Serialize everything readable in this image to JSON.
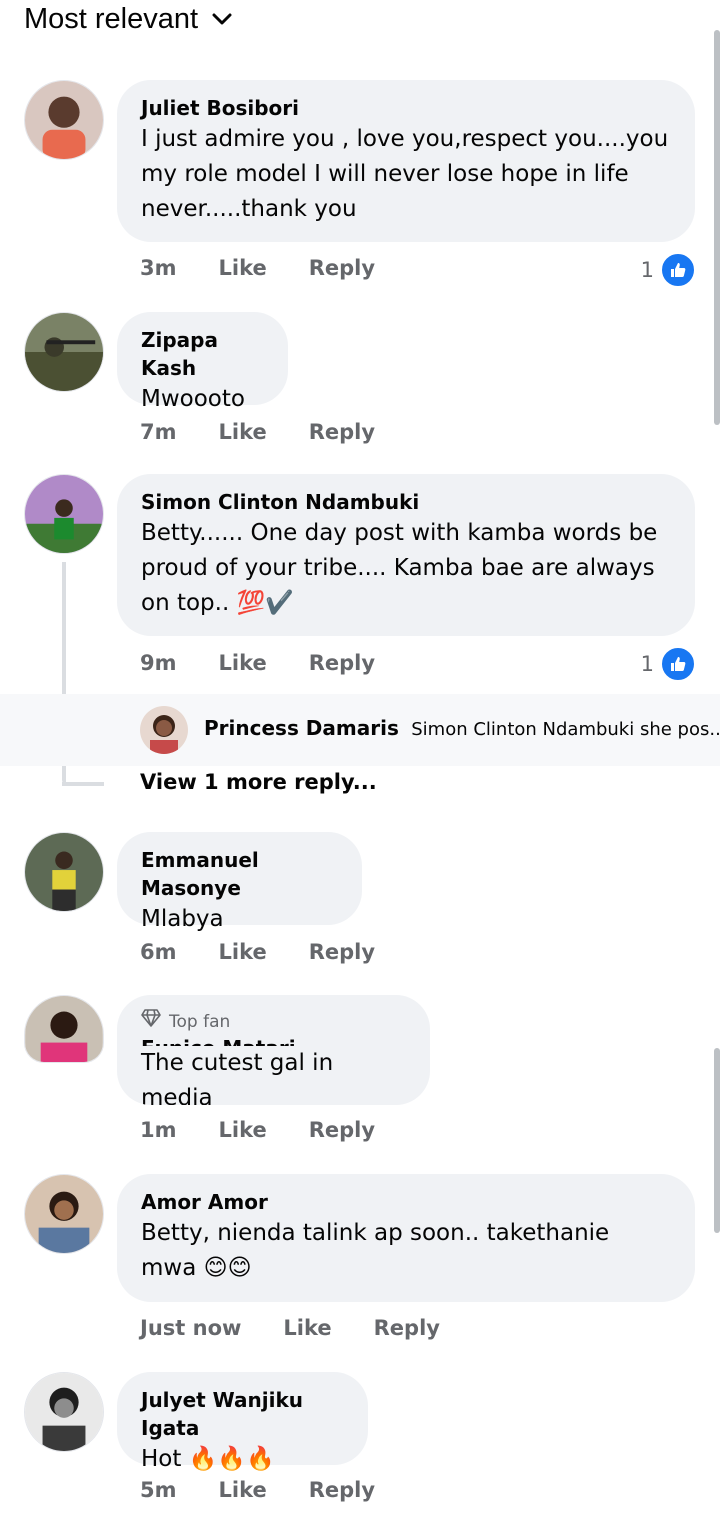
{
  "sort": {
    "label": "Most relevant"
  },
  "comments": [
    {
      "author": "Juliet Bosibori",
      "text": "I just admire you , love you,respect you....you my role model I will never lose hope in life never.....thank you",
      "time": "3m",
      "like": "Like",
      "reply": "Reply",
      "reaction_count": "1"
    },
    {
      "author": "Zipapa Kash",
      "text": "Mwoooto",
      "time": "7m",
      "like": "Like",
      "reply": "Reply"
    },
    {
      "author": "Simon Clinton Ndambuki",
      "text": "Betty...... One day post with kamba words be proud of your tribe.... Kamba bae are always on top.. 💯✔️",
      "time": "9m",
      "like": "Like",
      "reply": "Reply",
      "reaction_count": "1",
      "reply_preview": {
        "author": "Princess Damaris",
        "snippet": "Simon Clinton Ndambuki she pos..."
      },
      "view_more": "View 1 more reply..."
    },
    {
      "author": "Emmanuel Masonye",
      "text": "Mlabya",
      "time": "6m",
      "like": "Like",
      "reply": "Reply"
    },
    {
      "badge": "Top fan",
      "author": "Eunice Matari",
      "text": "The cutest gal in media",
      "time": "1m",
      "like": "Like",
      "reply": "Reply"
    },
    {
      "author": "Amor Amor",
      "text": "Betty, nienda talink ap soon.. takethanie mwa 😊😊",
      "time": "Just now",
      "like": "Like",
      "reply": "Reply"
    },
    {
      "author": "Julyet Wanjiku Igata",
      "text": "Hot 🔥🔥🔥",
      "time": "5m",
      "like": "Like",
      "reply": "Reply"
    }
  ],
  "colors": {
    "bubble": "#f0f2f5",
    "secondary_text": "#65676b",
    "like_blue": "#1877f2"
  }
}
